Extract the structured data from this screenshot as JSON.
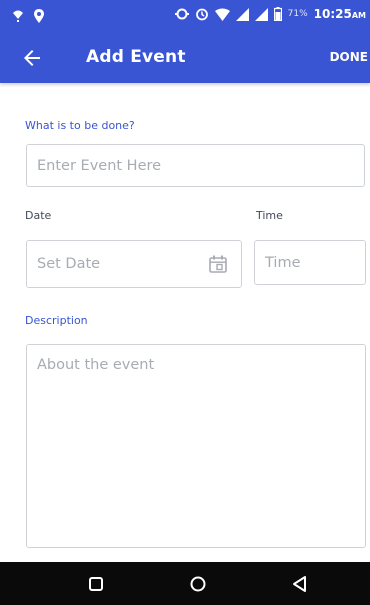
{
  "status_bar": {
    "battery": "71%",
    "time": "10:25",
    "time_suffix": "AM"
  },
  "app_bar": {
    "title": "Add Event",
    "done_label": "DONE"
  },
  "form": {
    "event_label": "What is to be done?",
    "event_placeholder": "Enter Event Here",
    "date_label": "Date",
    "date_placeholder": "Set Date",
    "time_label": "Time",
    "time_placeholder": "Time",
    "description_label": "Description",
    "description_placeholder": "About the event"
  },
  "colors": {
    "primary": "#3a55d3",
    "label_accent": "#3a55d3",
    "label_dark": "#444a5a",
    "border": "#cfd3d8",
    "placeholder": "#a7acb2",
    "nav_bar": "#0a0a0a"
  },
  "icons": {
    "status_left": [
      "wifi-question-icon",
      "location-icon"
    ],
    "status_right": [
      "sync-icon",
      "alarm-icon",
      "wifi-icon",
      "signal-icon",
      "signal-icon",
      "battery-icon"
    ],
    "app_bar": [
      "back-arrow-icon"
    ],
    "form": [
      "calendar-icon"
    ],
    "nav": [
      "recent-apps-icon",
      "home-icon",
      "back-triangle-icon"
    ]
  }
}
